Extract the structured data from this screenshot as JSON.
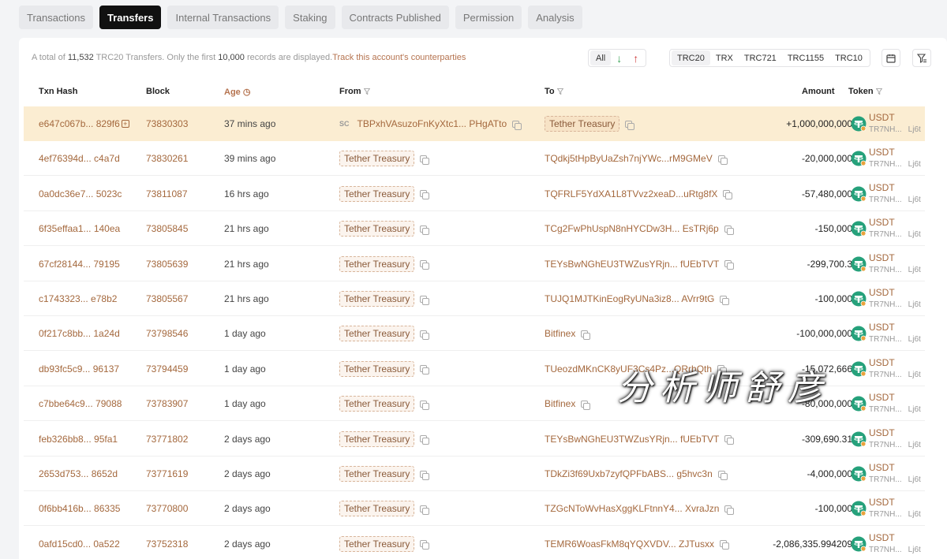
{
  "tabs": [
    "Transactions",
    "Transfers",
    "Internal Transactions",
    "Staking",
    "Contracts Published",
    "Permission",
    "Analysis"
  ],
  "active_tab": "Transfers",
  "summary": {
    "prefix": "A total of",
    "total": "11,532",
    "mid": "TRC20 Transfers. Only the first",
    "limit": "10,000",
    "suffix": "records are displayed.",
    "link": "Track this account's counterparties"
  },
  "direction_filter": {
    "all": "All",
    "in_icon": "arrow-down-icon",
    "out_icon": "arrow-up-icon"
  },
  "token_types": [
    "TRC20",
    "TRX",
    "TRC721",
    "TRC1155",
    "TRC10"
  ],
  "columns": {
    "hash": "Txn Hash",
    "block": "Block",
    "age": "Age",
    "from": "From",
    "to": "To",
    "amount": "Amount",
    "token": "Token"
  },
  "rows": [
    {
      "hash": "e647c067b... 829f6",
      "block": "73830303",
      "age": "37 mins ago",
      "from": "TBPxhVAsuzoFnKyXtc1... PHgATto",
      "from_tag": "SC",
      "to": "Tether Treasury",
      "amount": "+1,000,000,000",
      "token": "USDT",
      "token_addr": "TR7NH...",
      "token_addr2": "Lj6t",
      "highlight": true
    },
    {
      "hash": "4ef76394d... c4a7d",
      "block": "73830261",
      "age": "39 mins ago",
      "from": "Tether Treasury",
      "to": "TQdkj5tHpByUaZsh7njYWc...rM9GMeV",
      "amount": "-20,000,000",
      "token": "USDT",
      "token_addr": "TR7NH...",
      "token_addr2": "Lj6t"
    },
    {
      "hash": "0a0dc36e7... 5023c",
      "block": "73811087",
      "age": "16 hrs ago",
      "from": "Tether Treasury",
      "to": "TQFRLF5YdXA1L8TVvz2xeaD...uRtg8fX",
      "amount": "-57,480,000",
      "token": "USDT",
      "token_addr": "TR7NH...",
      "token_addr2": "Lj6t"
    },
    {
      "hash": "6f35effaa1... 140ea",
      "block": "73805845",
      "age": "21 hrs ago",
      "from": "Tether Treasury",
      "to": "TCg2FwPhUspN8nHYCDw3H... EsTRj6p",
      "amount": "-150,000",
      "token": "USDT",
      "token_addr": "TR7NH...",
      "token_addr2": "Lj6t"
    },
    {
      "hash": "67cf28144... 79195",
      "block": "73805639",
      "age": "21 hrs ago",
      "from": "Tether Treasury",
      "to": "TEYsBwNGhEU3TWZusYRjn... fUEbTVT",
      "amount": "-299,700.3",
      "token": "USDT",
      "token_addr": "TR7NH...",
      "token_addr2": "Lj6t"
    },
    {
      "hash": "c1743323... e78b2",
      "block": "73805567",
      "age": "21 hrs ago",
      "from": "Tether Treasury",
      "to": "TUJQ1MJTKinEogRyUNa3iz8... AVrr9tG",
      "amount": "-100,000",
      "token": "USDT",
      "token_addr": "TR7NH...",
      "token_addr2": "Lj6t"
    },
    {
      "hash": "0f217c8bb... 1a24d",
      "block": "73798546",
      "age": "1 day ago",
      "from": "Tether Treasury",
      "to": "Bitfinex",
      "to_is_tag": true,
      "amount": "-100,000,000",
      "token": "USDT",
      "token_addr": "TR7NH...",
      "token_addr2": "Lj6t"
    },
    {
      "hash": "db93fc5c9... 96137",
      "block": "73794459",
      "age": "1 day ago",
      "from": "Tether Treasury",
      "to": "TUeozdMKnCK8yUF3Cs4Pz...QRrhQth",
      "amount": "-15,072,666",
      "token": "USDT",
      "token_addr": "TR7NH...",
      "token_addr2": "Lj6t"
    },
    {
      "hash": "c7bbe64c9... 79088",
      "block": "73783907",
      "age": "1 day ago",
      "from": "Tether Treasury",
      "to": "Bitfinex",
      "to_is_tag": true,
      "amount": "-80,000,000",
      "token": "USDT",
      "token_addr": "TR7NH...",
      "token_addr2": "Lj6t"
    },
    {
      "hash": "feb326bb8... 95fa1",
      "block": "73771802",
      "age": "2 days ago",
      "from": "Tether Treasury",
      "to": "TEYsBwNGhEU3TWZusYRjn... fUEbTVT",
      "amount": "-309,690.31",
      "token": "USDT",
      "token_addr": "TR7NH...",
      "token_addr2": "Lj6t"
    },
    {
      "hash": "2653d753... 8652d",
      "block": "73771619",
      "age": "2 days ago",
      "from": "Tether Treasury",
      "to": "TDkZi3f69Uxb7zyfQPFbABS... g5hvc3n",
      "amount": "-4,000,000",
      "token": "USDT",
      "token_addr": "TR7NH...",
      "token_addr2": "Lj6t"
    },
    {
      "hash": "0f6bb416b... 86335",
      "block": "73770800",
      "age": "2 days ago",
      "from": "Tether Treasury",
      "to": "TZGcNToWvHasXggKLFtnnY4... XvraJzn",
      "amount": "-100,000",
      "token": "USDT",
      "token_addr": "TR7NH...",
      "token_addr2": "Lj6t"
    },
    {
      "hash": "0afd15cd0... 0a522",
      "block": "73752318",
      "age": "2 days ago",
      "from": "Tether Treasury",
      "to": "TEMR6WoasFkM8qYQXVDV... ZJTusxx",
      "amount": "-2,086,335.994209",
      "token": "USDT",
      "token_addr": "TR7NH...",
      "token_addr2": "Lj6t"
    }
  ],
  "watermark": "分析师舒彦",
  "colors": {
    "link": "#a4683d",
    "highlight": "#fbedd2",
    "tether": "#26a17b"
  }
}
